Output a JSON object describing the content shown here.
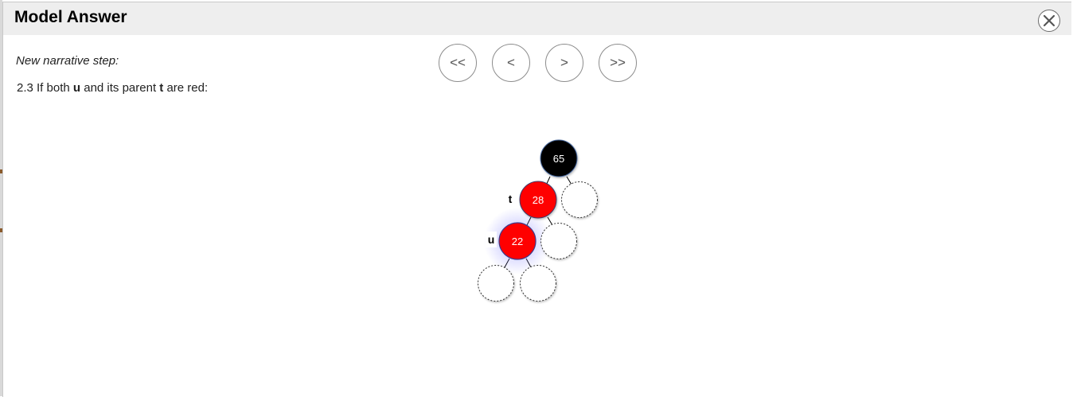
{
  "dialog": {
    "title": "Model Answer"
  },
  "step": {
    "caption": "New narrative step:",
    "text_prefix": "2.3 If both ",
    "var_u": "u",
    "text_middle": " and its parent ",
    "var_t": "t",
    "text_suffix": " are red:"
  },
  "nav": {
    "first": "<<",
    "prev": "<",
    "next": ">",
    "last": ">>"
  },
  "tree": {
    "nodes": [
      {
        "id": "65",
        "value": "65",
        "color": "black"
      },
      {
        "id": "28",
        "value": "28",
        "color": "red",
        "label": "t"
      },
      {
        "id": "22",
        "value": "22",
        "color": "red",
        "label": "u",
        "highlighted": true
      }
    ],
    "colors": {
      "black_node": "#000000",
      "red_node": "#ff0000",
      "node_text": "#ffffff",
      "highlight_glow": "#7f7fff"
    }
  }
}
